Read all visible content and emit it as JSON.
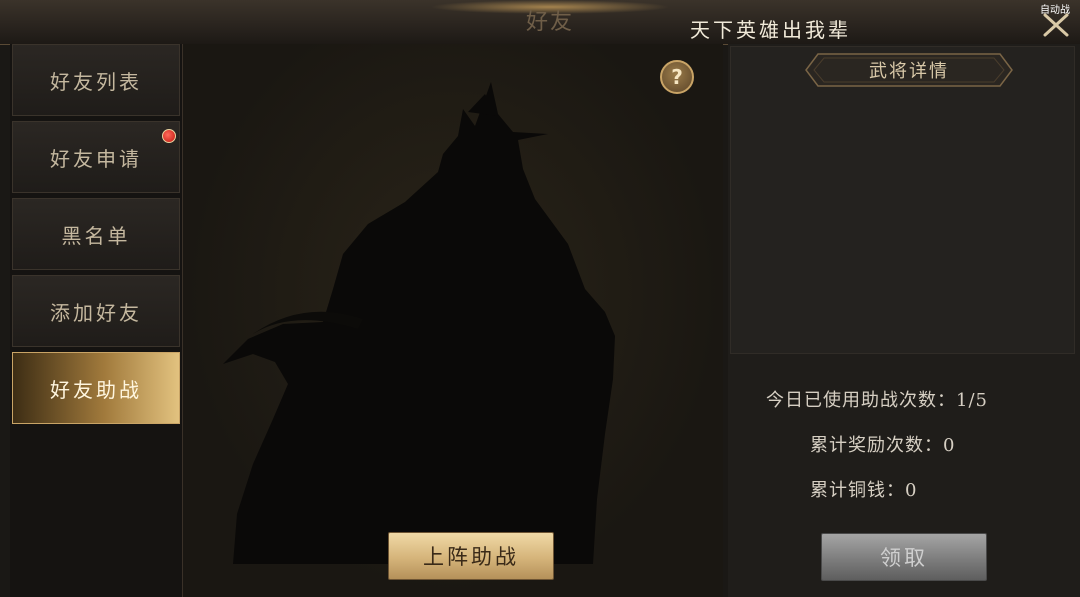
{
  "header": {
    "title": "好友",
    "player_name": "天下英雄出我辈",
    "auto_battle": "自动战"
  },
  "tabs": [
    {
      "label": "好友列表"
    },
    {
      "label": "好友申请",
      "has_notification": true
    },
    {
      "label": "黑名单"
    },
    {
      "label": "添加好友"
    },
    {
      "label": "好友助战",
      "active": true
    }
  ],
  "hero_panel": {
    "help_label": "?",
    "deploy_label": "上阵助战"
  },
  "detail": {
    "tag_label": "武将详情"
  },
  "stats": {
    "used_label": "今日已使用助战次数：",
    "used_value": "1/5",
    "reward_label": "累计奖励次数：",
    "reward_value": "0",
    "coin_label": "累计铜钱：",
    "coin_value": "0"
  },
  "claim_label": "领取",
  "colors": {
    "accent_gold": "#c9a466",
    "active_tab": "#a17a3c",
    "notification": "#c0140d",
    "disabled_button": "#7d7d7d"
  },
  "icons": [
    "close-icon",
    "help-icon",
    "notification-dot",
    "hero-silhouette"
  ]
}
